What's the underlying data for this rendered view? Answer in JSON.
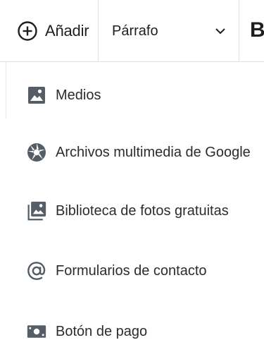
{
  "toolbar": {
    "add_label": "Añadir",
    "block_type_label": "Párrafo",
    "bold_label": "B"
  },
  "menu": {
    "items": [
      {
        "label": "Medios",
        "icon": "image-icon"
      },
      {
        "label": "Archivos multimedia de Google",
        "icon": "google-photos-icon"
      },
      {
        "label": "Biblioteca de fotos gratuitas",
        "icon": "photo-library-icon"
      },
      {
        "label": "Formularios de contacto",
        "icon": "at-sign-icon"
      },
      {
        "label": "Botón de pago",
        "icon": "payment-button-icon"
      }
    ]
  },
  "colors": {
    "icon": "#555d66",
    "text": "#2c2c2c",
    "border": "#e0e0e0"
  }
}
